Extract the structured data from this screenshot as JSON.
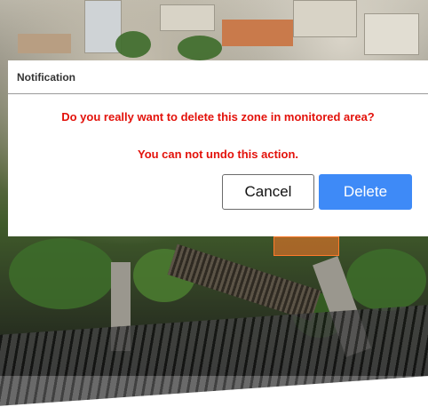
{
  "dialog": {
    "title": "Notification",
    "message_primary": "Do you really want to delete this zone in monitored area?",
    "message_secondary": "You can not undo this action.",
    "cancel_label": "Cancel",
    "delete_label": "Delete"
  },
  "colors": {
    "message_text": "#e3120b",
    "delete_button": "#3e8af7",
    "zone_overlay": "#ff7a2a"
  }
}
